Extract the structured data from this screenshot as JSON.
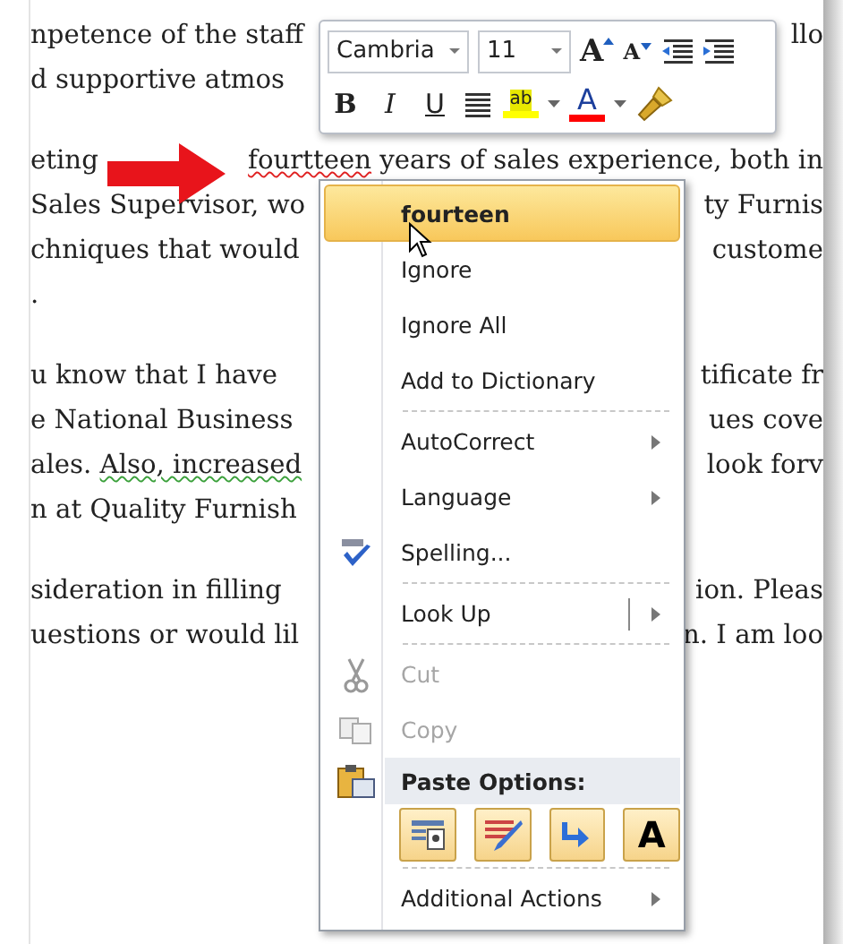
{
  "document": {
    "paragraphs": [
      {
        "lines": [
          {
            "left": [
              {
                "text": "npetence of the staff"
              }
            ],
            "right": "llo"
          },
          {
            "left": [
              {
                "text": "d supportive atmos"
              }
            ]
          }
        ]
      },
      {
        "lines": [
          {
            "left": [
              {
                "text": "eting"
              }
            ],
            "right_segments": [
              {
                "text": "fourtteen",
                "misspelled": true
              },
              {
                "text": " years of sales experience, both in"
              }
            ]
          },
          {
            "left": [
              {
                "text": "Sales Supervisor, wo"
              }
            ],
            "right": "ty Furnis"
          },
          {
            "left": [
              {
                "text": "chniques that would"
              }
            ],
            "right": "custome"
          },
          {
            "left": [
              {
                "text": "."
              }
            ]
          }
        ]
      },
      {
        "lines": [
          {
            "left": [
              {
                "text": "u know that I have"
              }
            ],
            "right": "tificate fr"
          },
          {
            "left": [
              {
                "text": "e National Business"
              }
            ],
            "right": "ues cove"
          },
          {
            "left": [
              {
                "text": "ales. "
              },
              {
                "text": "Also, increased",
                "grammar_error": true
              }
            ],
            "right": "look forv"
          },
          {
            "left": [
              {
                "text": "n at Quality Furnish"
              }
            ]
          }
        ]
      },
      {
        "lines": [
          {
            "left": [
              {
                "text": "sideration in filling"
              }
            ],
            "right": "ion. Pleas"
          },
          {
            "left": [
              {
                "text": "uestions or would lil"
              }
            ],
            "right": "n. I am loo"
          }
        ]
      }
    ]
  },
  "mini_toolbar": {
    "font": "Cambria",
    "size": "11",
    "row1": [
      {
        "kind": "grow",
        "glyph": "A"
      },
      {
        "kind": "shrink",
        "glyph": "A"
      },
      {
        "kind": "outdent"
      },
      {
        "kind": "indent"
      }
    ],
    "row2": [
      {
        "kind": "bold",
        "glyph": "B"
      },
      {
        "kind": "italic",
        "glyph": "I"
      },
      {
        "kind": "underline",
        "glyph": "U"
      },
      {
        "kind": "center"
      },
      {
        "kind": "highlight",
        "glyph": "ab",
        "color": "#ffff00"
      },
      {
        "kind": "caret"
      },
      {
        "kind": "fontcolor",
        "glyph": "A",
        "color": "#ff0000"
      },
      {
        "kind": "caret"
      },
      {
        "kind": "painter"
      }
    ]
  },
  "context_menu": {
    "items": [
      {
        "kind": "suggestion",
        "label": "fourteen",
        "selected": true
      },
      {
        "kind": "item",
        "label": "Ignore",
        "selected": false
      },
      {
        "kind": "item",
        "label": "Ignore All",
        "selected": false
      },
      {
        "kind": "item",
        "label": "Add to Dictionary",
        "selected": false
      },
      {
        "kind": "separator"
      },
      {
        "kind": "submenu",
        "label": "AutoCorrect",
        "selected": false
      },
      {
        "kind": "submenu",
        "label": "Language",
        "selected": false
      },
      {
        "kind": "spelling",
        "label": "Spelling...",
        "selected": false
      },
      {
        "kind": "separator"
      },
      {
        "kind": "split",
        "label": "Look Up",
        "selected": false
      },
      {
        "kind": "separator"
      },
      {
        "kind": "cut",
        "label": "Cut",
        "disabled": true,
        "selected": false
      },
      {
        "kind": "copy",
        "label": "Copy",
        "disabled": true,
        "selected": false
      },
      {
        "kind": "header",
        "label": "Paste Options:"
      },
      {
        "kind": "paste_row",
        "buttons": [
          {
            "kind": "keep_source"
          },
          {
            "kind": "merge"
          },
          {
            "kind": "link"
          },
          {
            "kind": "text_only",
            "glyph": "A"
          }
        ]
      },
      {
        "kind": "separator"
      },
      {
        "kind": "submenu",
        "label": "Additional Actions",
        "selected": false
      }
    ]
  }
}
